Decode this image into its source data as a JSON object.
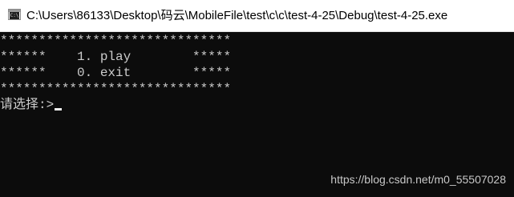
{
  "window": {
    "title": "C:\\Users\\86133\\Desktop\\码云\\MobileFile\\test\\c\\c\\test-4-25\\Debug\\test-4-25.exe",
    "icon": "console-app-icon",
    "icon_glyph": "C:\\"
  },
  "console": {
    "lines": [
      "******************************",
      "******    1. play        *****",
      "******    0. exit        *****",
      "******************************"
    ],
    "prompt": "请选择:>"
  },
  "watermark": "https://blog.csdn.net/m0_55507028",
  "colors": {
    "background": "#0c0c0c",
    "text": "#cccccc",
    "titlebar": "#ffffff"
  }
}
